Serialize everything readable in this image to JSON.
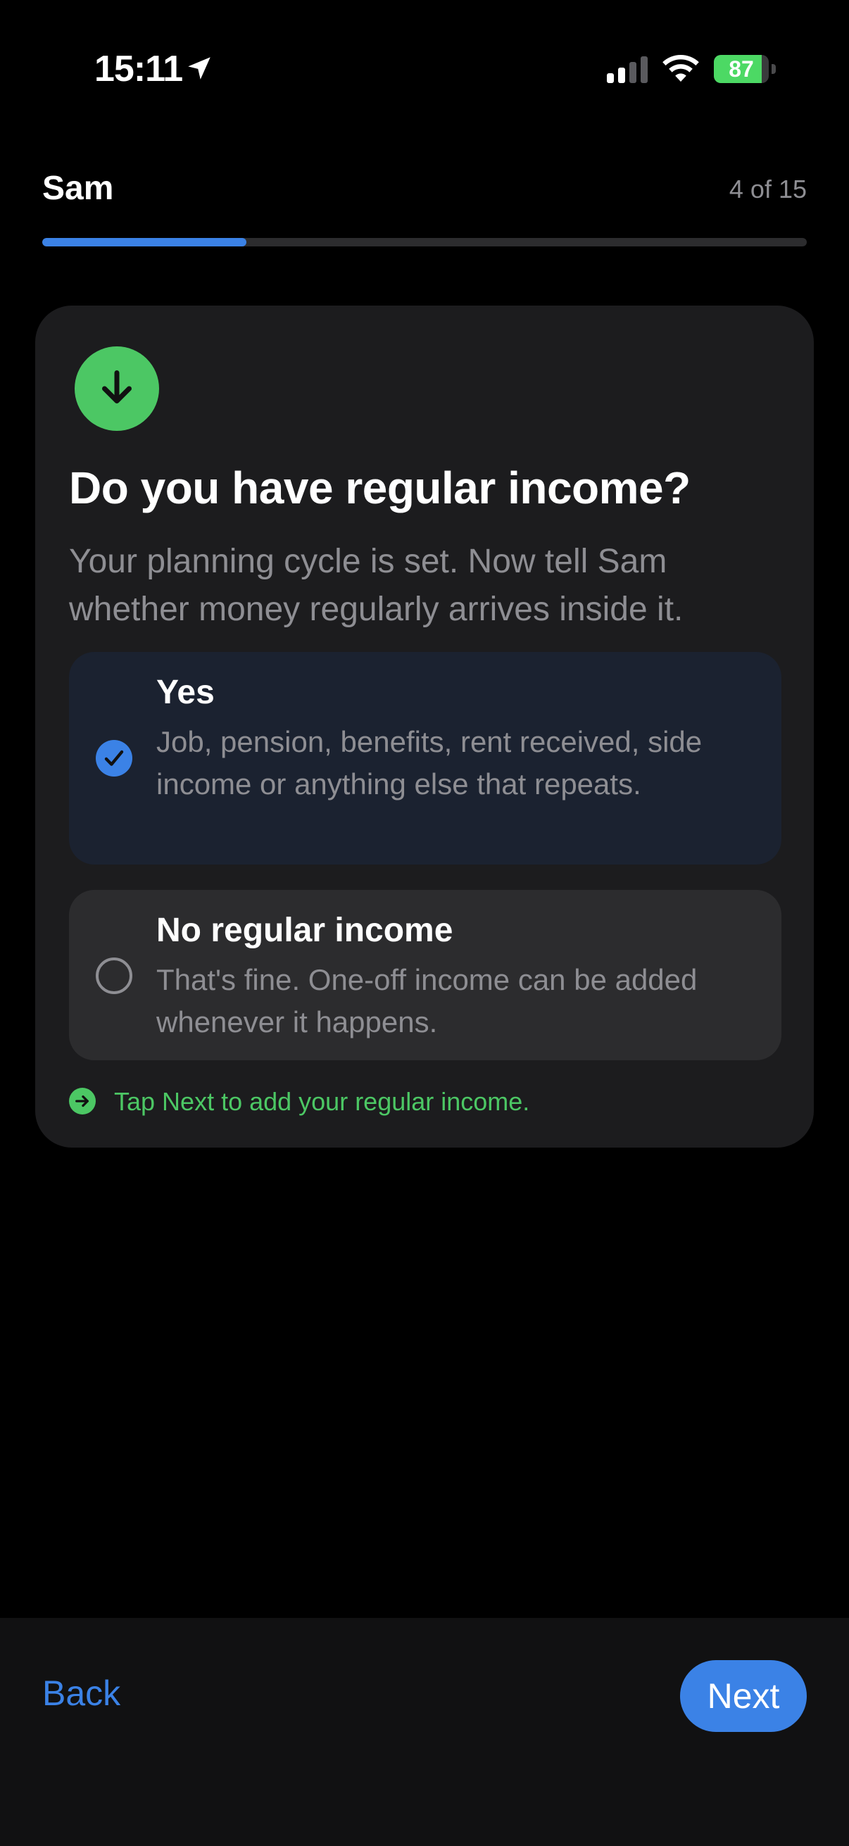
{
  "status_bar": {
    "time": "15:11",
    "battery_percent": "87",
    "battery_level": 0.87,
    "icons": [
      "location-arrow-icon",
      "cellular-signal-icon",
      "wifi-icon",
      "battery-charging-icon"
    ]
  },
  "header": {
    "title": "Sam",
    "step_counter": "4 of 15",
    "progress": 0.267
  },
  "card": {
    "icon": "arrow-down-icon",
    "title": "Do you have regular income?",
    "subtitle": "Your planning cycle is set. Now tell Sam whether money regularly arrives inside it.",
    "options": [
      {
        "title": "Yes",
        "description": "Job, pension, benefits, rent received, side income or anything else that repeats.",
        "selected": true
      },
      {
        "title": "No regular income",
        "description": "That's fine. One-off income can be added whenever it happens.",
        "selected": false
      }
    ],
    "hint": "Tap Next to add your regular income."
  },
  "footer": {
    "back_label": "Back",
    "next_label": "Next"
  },
  "colors": {
    "accent": "#3b82e6",
    "success": "#4cc764",
    "card_bg": "#1c1c1e",
    "selected_bg": "#1b2230",
    "muted_text": "#8e8e93"
  }
}
